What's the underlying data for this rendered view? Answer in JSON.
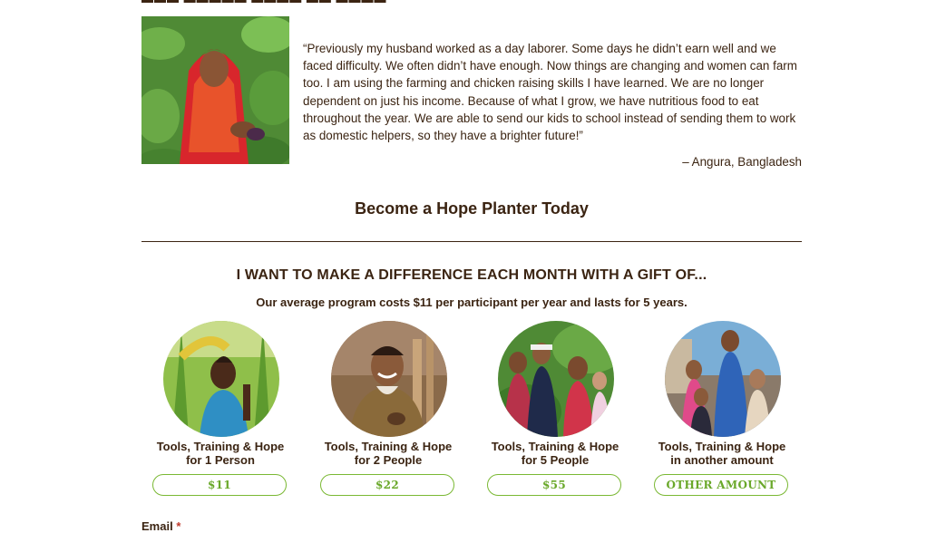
{
  "testimonial": {
    "quote": "“Previously my husband worked as a day laborer.  Some days he didn’t earn well and we faced difficulty.  We often didn’t have enough.  Now things are changing and women can farm too.  I am using the farming and chicken raising skills I have learned. We are no longer dependent on just his income.  Because of what I grow, we have nutritious food to eat throughout the year.  We are able to send our kids to school instead of sending them to work as domestic helpers, so they have a brighter future!”",
    "attribution": "– Angura, Bangladesh"
  },
  "cta": {
    "heading": "Become a Hope Planter Today"
  },
  "gift": {
    "heading": "I WANT TO MAKE A DIFFERENCE EACH MONTH WITH A GIFT OF...",
    "subheading": "Our average program costs $11 per participant per year and lasts for 5 years."
  },
  "options": [
    {
      "line1": "Tools, Training & Hope",
      "line2": "for 1 Person",
      "amount": "$11"
    },
    {
      "line1": "Tools, Training & Hope",
      "line2": "for 2 People",
      "amount": "$22"
    },
    {
      "line1": "Tools, Training & Hope",
      "line2": "for 5 People",
      "amount": "$55"
    },
    {
      "line1": "Tools, Training & Hope",
      "line2": "in another amount",
      "amount": "OTHER AMOUNT"
    }
  ],
  "form": {
    "email_label": "Email",
    "required_marker": "*"
  },
  "colors": {
    "text": "#3b2412",
    "accent_green": "#7ab833"
  }
}
